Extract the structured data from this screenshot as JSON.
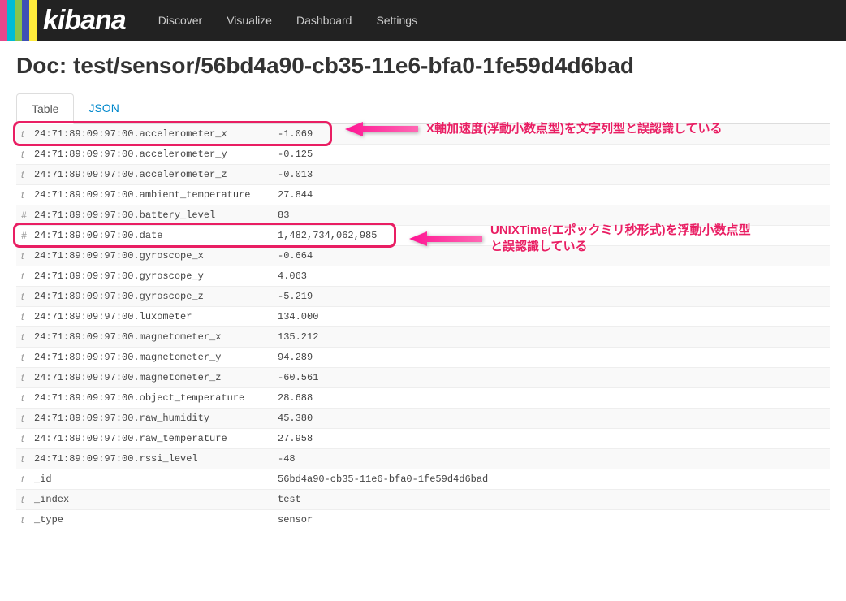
{
  "brand": "kibana",
  "stripes": [
    "#e8478b",
    "#00bcd4",
    "#8bc34a",
    "#3f51b5",
    "#ffeb3b"
  ],
  "nav": [
    {
      "label": "Discover"
    },
    {
      "label": "Visualize"
    },
    {
      "label": "Dashboard"
    },
    {
      "label": "Settings"
    }
  ],
  "doc": {
    "label": "Doc:",
    "path": "test/sensor/56bd4a90-cb35-11e6-bfa0-1fe59d4d6bad"
  },
  "tabs": [
    {
      "label": "Table",
      "active": true
    },
    {
      "label": "JSON",
      "active": false
    }
  ],
  "fields": [
    {
      "type": "t",
      "name": "24:71:89:09:97:00.accelerometer_x",
      "value": "-1.069",
      "highlight": true
    },
    {
      "type": "t",
      "name": "24:71:89:09:97:00.accelerometer_y",
      "value": "-0.125"
    },
    {
      "type": "t",
      "name": "24:71:89:09:97:00.accelerometer_z",
      "value": "-0.013"
    },
    {
      "type": "t",
      "name": "24:71:89:09:97:00.ambient_temperature",
      "value": "27.844"
    },
    {
      "type": "#",
      "name": "24:71:89:09:97:00.battery_level",
      "value": "83"
    },
    {
      "type": "#",
      "name": "24:71:89:09:97:00.date",
      "value": "1,482,734,062,985",
      "highlight": true
    },
    {
      "type": "t",
      "name": "24:71:89:09:97:00.gyroscope_x",
      "value": "-0.664"
    },
    {
      "type": "t",
      "name": "24:71:89:09:97:00.gyroscope_y",
      "value": "4.063"
    },
    {
      "type": "t",
      "name": "24:71:89:09:97:00.gyroscope_z",
      "value": "-5.219"
    },
    {
      "type": "t",
      "name": "24:71:89:09:97:00.luxometer",
      "value": "134.000"
    },
    {
      "type": "t",
      "name": "24:71:89:09:97:00.magnetometer_x",
      "value": "135.212"
    },
    {
      "type": "t",
      "name": "24:71:89:09:97:00.magnetometer_y",
      "value": "94.289"
    },
    {
      "type": "t",
      "name": "24:71:89:09:97:00.magnetometer_z",
      "value": "-60.561"
    },
    {
      "type": "t",
      "name": "24:71:89:09:97:00.object_temperature",
      "value": "28.688"
    },
    {
      "type": "t",
      "name": "24:71:89:09:97:00.raw_humidity",
      "value": "45.380"
    },
    {
      "type": "t",
      "name": "24:71:89:09:97:00.raw_temperature",
      "value": "27.958"
    },
    {
      "type": "t",
      "name": "24:71:89:09:97:00.rssi_level",
      "value": "-48"
    },
    {
      "type": "t",
      "name": "_id",
      "value": "56bd4a90-cb35-11e6-bfa0-1fe59d4d6bad"
    },
    {
      "type": "t",
      "name": "_index",
      "value": "test"
    },
    {
      "type": "t",
      "name": "_type",
      "value": "sensor"
    }
  ],
  "annotations": [
    {
      "row": 0,
      "text": "X軸加速度(浮動小数点型)を文字列型と誤認識している"
    },
    {
      "row": 5,
      "text": "UNIXTime(エポックミリ秒形式)を浮動小数点型\nと誤認識している"
    }
  ]
}
